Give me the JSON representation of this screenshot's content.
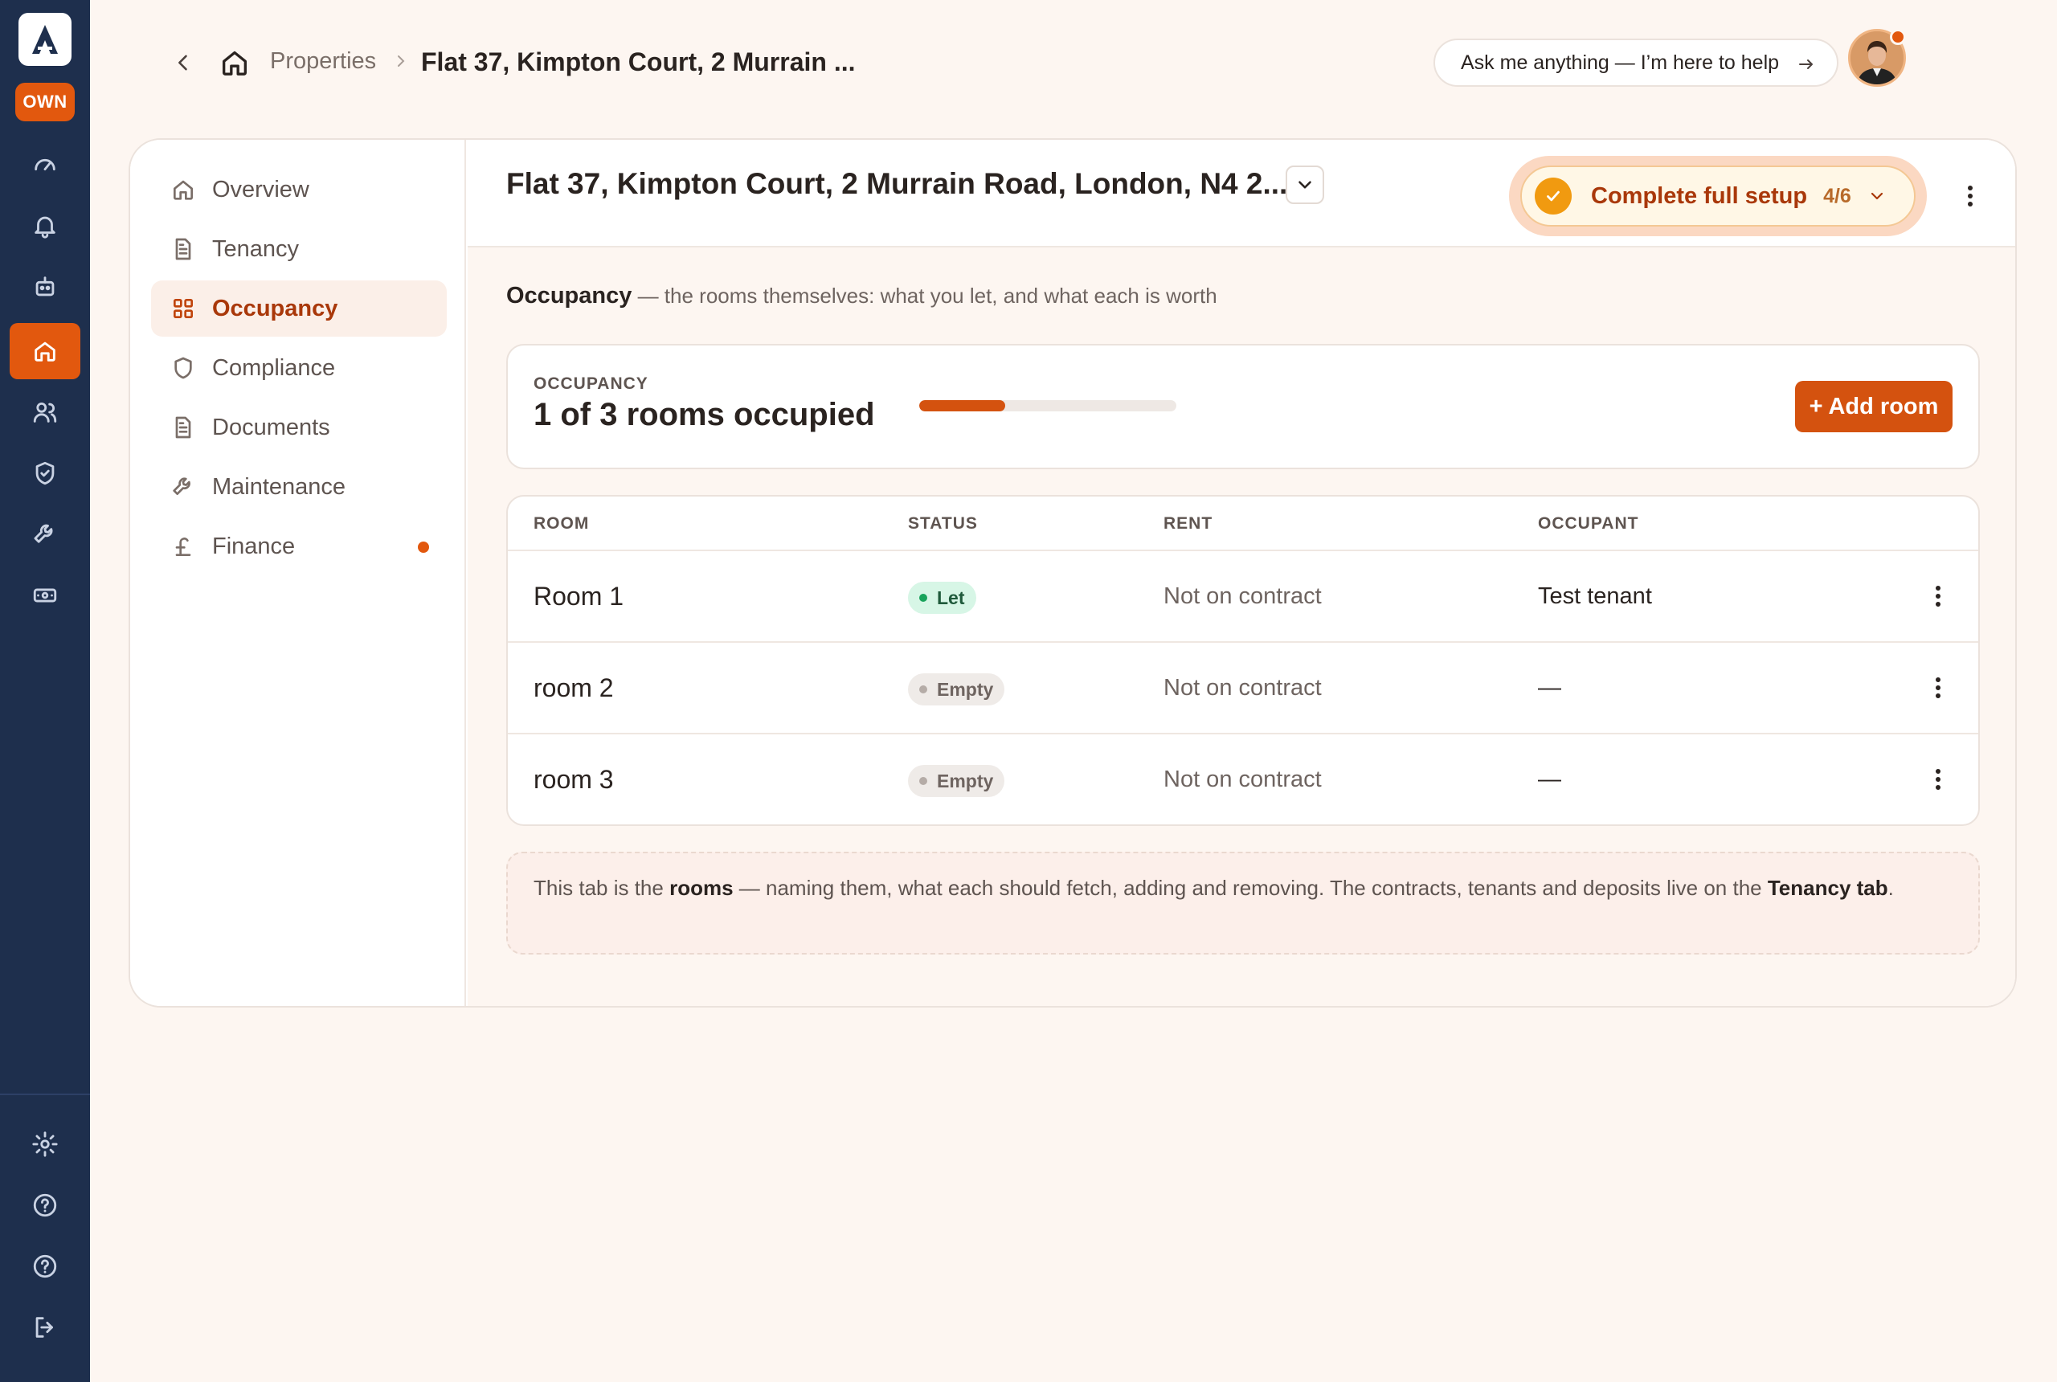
{
  "rail": {
    "brand_badge": "OWN",
    "items": [
      {
        "name": "dashboard",
        "icon": "gauge-icon"
      },
      {
        "name": "notifications",
        "icon": "bell-icon"
      },
      {
        "name": "assistant",
        "icon": "robot-icon"
      },
      {
        "name": "properties",
        "icon": "home-icon",
        "active": true
      },
      {
        "name": "tenants",
        "icon": "users-icon"
      },
      {
        "name": "compliance",
        "icon": "shield-check-icon"
      },
      {
        "name": "maintenance",
        "icon": "wrench-icon"
      },
      {
        "name": "finance",
        "icon": "money-icon"
      }
    ],
    "bottom_items": [
      {
        "name": "settings",
        "icon": "gear-icon"
      },
      {
        "name": "help",
        "icon": "help-circle-icon"
      },
      {
        "name": "support",
        "icon": "help-circle-icon"
      },
      {
        "name": "logout",
        "icon": "logout-icon"
      }
    ]
  },
  "header": {
    "breadcrumb_parent": "Properties",
    "breadcrumb_current": "Flat 37, Kimpton Court, 2 Murrain ...",
    "ask_label": "Ask me anything — I’m here to help"
  },
  "subnav": {
    "items": [
      {
        "label": "Overview",
        "icon": "home-icon"
      },
      {
        "label": "Tenancy",
        "icon": "document-icon"
      },
      {
        "label": "Occupancy",
        "icon": "grid-icon",
        "active": true
      },
      {
        "label": "Compliance",
        "icon": "shield-icon"
      },
      {
        "label": "Documents",
        "icon": "document-icon"
      },
      {
        "label": "Maintenance",
        "icon": "wrench-icon"
      },
      {
        "label": "Finance",
        "icon": "pound-icon",
        "has_dot": true
      }
    ]
  },
  "property": {
    "title": "Flat 37, Kimpton Court, 2 Murrain Road, London, N4 2..."
  },
  "setup": {
    "label": "Complete full setup",
    "progress": "4/6"
  },
  "intro": {
    "title": "Occupancy",
    "text": " — the rooms themselves: what you let, and what each is worth"
  },
  "occupancy": {
    "eyebrow": "OCCUPANCY",
    "summary": "1 of 3 rooms occupied",
    "occupied": 1,
    "total": 3,
    "add_button": "+ Add room"
  },
  "table": {
    "headers": {
      "room": "ROOM",
      "status": "STATUS",
      "rent": "RENT",
      "occupant": "OCCUPANT"
    },
    "rows": [
      {
        "room": "Room 1",
        "status": "Let",
        "rent": "Not on contract",
        "occupant": "Test tenant"
      },
      {
        "room": "room 2",
        "status": "Empty",
        "rent": "Not on contract",
        "occupant": "—"
      },
      {
        "room": "room 3",
        "status": "Empty",
        "rent": "Not on contract",
        "occupant": "—"
      }
    ]
  },
  "note": {
    "part1": "This tab is the ",
    "bold1": "rooms",
    "part2": " — naming them, what each should fetch, adding and removing. The contracts, tenants and deposits live on the ",
    "bold2": "Tenancy tab",
    "part3": "."
  },
  "colors": {
    "rail_bg": "#1e2f4d",
    "accent": "#e2580e",
    "page_bg": "#fdf6f1",
    "let_badge": "#d7f6e6",
    "empty_badge": "#efebe8"
  }
}
